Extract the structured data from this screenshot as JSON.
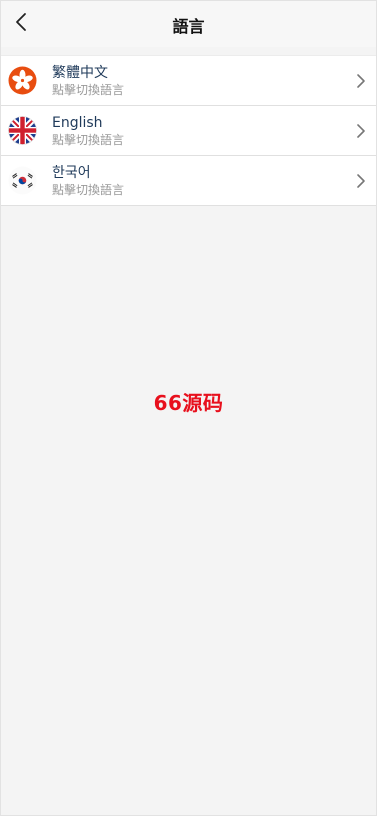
{
  "header": {
    "title": "語言",
    "back_icon": "back-chevron-icon"
  },
  "languages": [
    {
      "name": "繁體中文",
      "hint": "點擊切換語言",
      "flag": "hong-kong-flag-icon"
    },
    {
      "name": "English",
      "hint": "點擊切換語言",
      "flag": "uk-flag-icon"
    },
    {
      "name": "한국어",
      "hint": "點擊切換語言",
      "flag": "korea-flag-icon"
    }
  ],
  "row_chevron_icon": "chevron-right-icon",
  "watermark": {
    "text": "66源码",
    "color": "#e8101d"
  },
  "colors": {
    "background": "#f4f4f4",
    "header_background": "#f7f7f7",
    "language_name": "#1f3a5a",
    "hint_text": "#999999"
  }
}
